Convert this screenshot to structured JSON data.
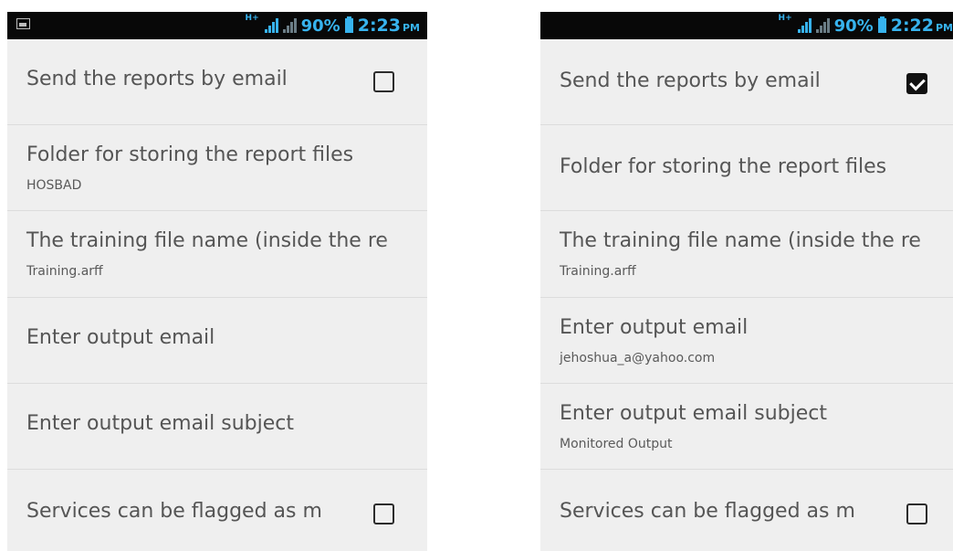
{
  "screens": [
    {
      "status": {
        "battery": "90%",
        "time": "2:23",
        "ampm": "PM",
        "network": "H+"
      },
      "settings": [
        {
          "title": "Send the reports by email",
          "checked": false
        },
        {
          "title": "Folder for storing the report files",
          "summary": "HOSBAD"
        },
        {
          "title": "The training file name (inside the re",
          "summary": "Training.arff"
        },
        {
          "title": "Enter output email",
          "summary": ""
        },
        {
          "title": "Enter output email subject",
          "summary": ""
        },
        {
          "title": "Services can be flagged as m",
          "checked": false
        }
      ]
    },
    {
      "status": {
        "battery": "90%",
        "time": "2:22",
        "ampm": "PM",
        "network": "H+"
      },
      "settings": [
        {
          "title": "Send the reports by email",
          "checked": true
        },
        {
          "title": "Folder for storing the report files",
          "summary": ""
        },
        {
          "title": "The training file name (inside the re",
          "summary": "Training.arff"
        },
        {
          "title": "Enter output email",
          "summary": "jehoshua_a@yahoo.com"
        },
        {
          "title": "Enter output email subject",
          "summary": "Monitored Output"
        },
        {
          "title": "Services can be flagged as m",
          "checked": false
        }
      ]
    }
  ],
  "colors": {
    "statusbar": "#080808",
    "status_accent": "#37b3ee",
    "list_background": "#efefef",
    "text": "#555555",
    "divider": "#dcdcdc"
  },
  "icons": [
    "picture-notification-icon",
    "hplus-signal-icon",
    "signal-bars-icon",
    "battery-icon",
    "checkbox-icon"
  ]
}
